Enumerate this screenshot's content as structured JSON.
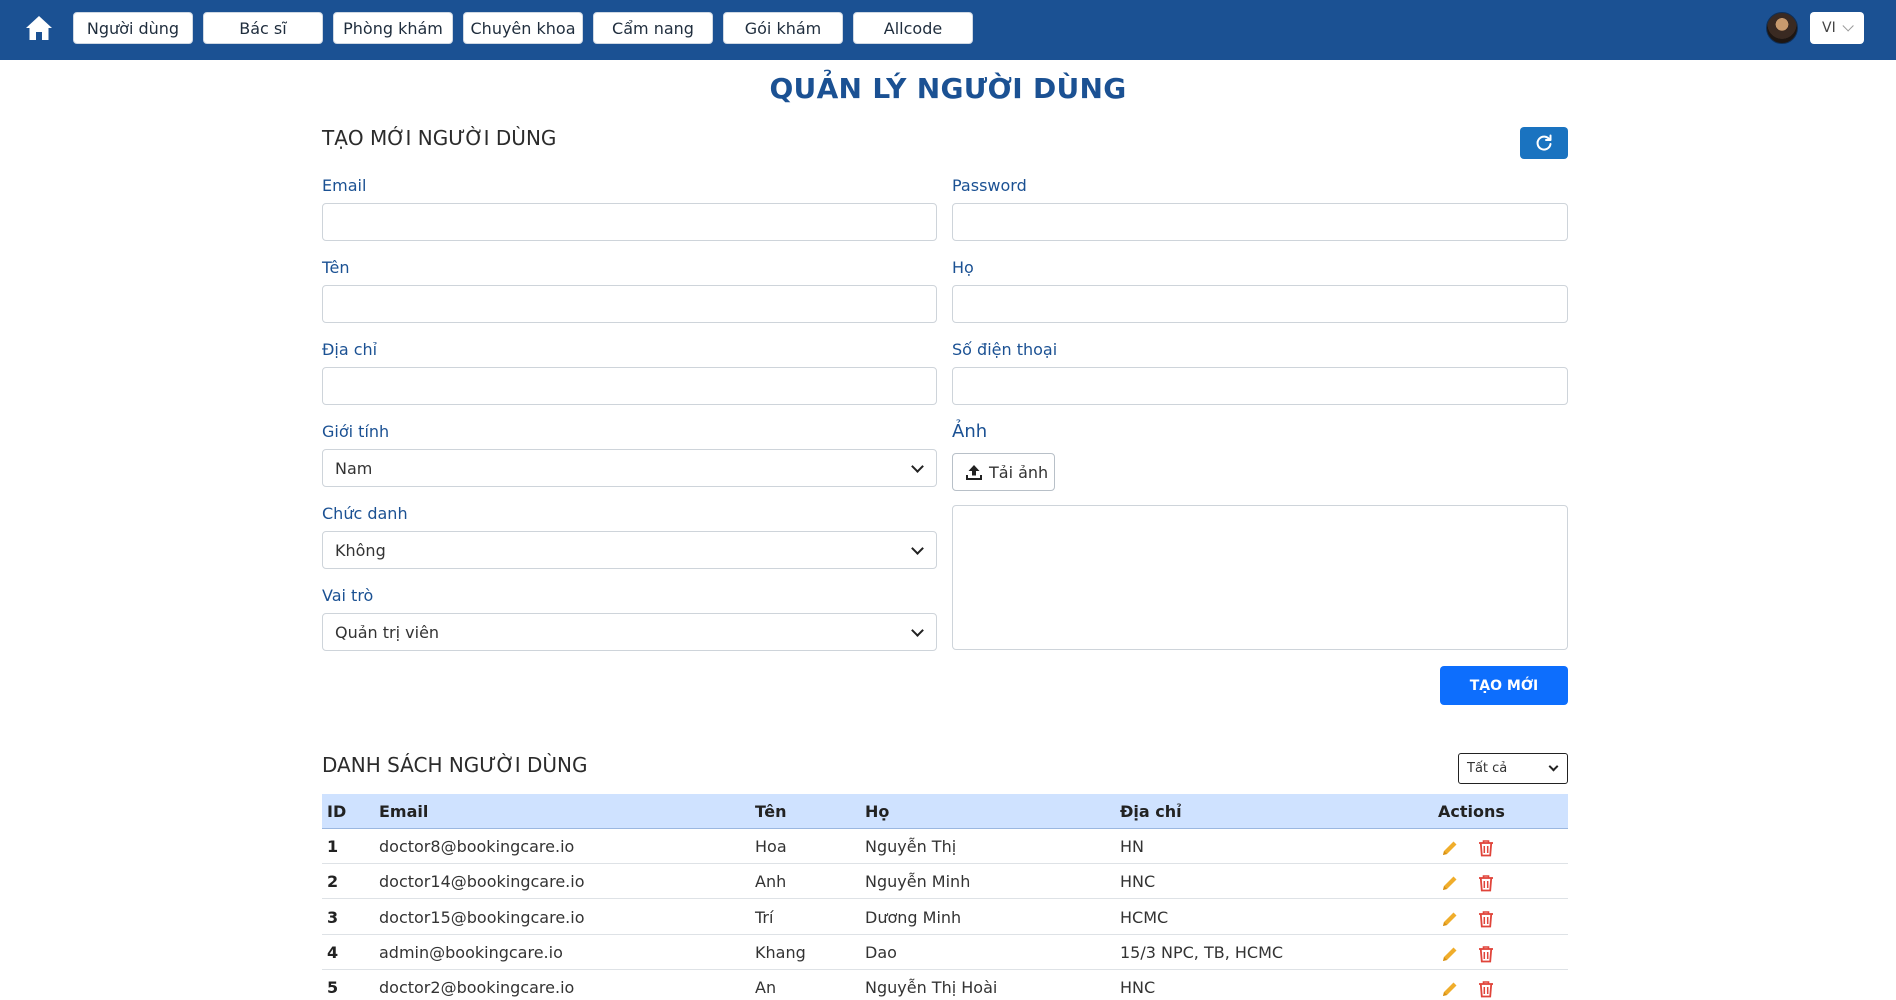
{
  "nav": {
    "items": [
      "Người dùng",
      "Bác sĩ",
      "Phòng khám",
      "Chuyên khoa",
      "Cẩm nang",
      "Gói khám",
      "Allcode"
    ],
    "lang": "VI"
  },
  "page_title": "QUẢN LÝ NGƯỜI DÙNG",
  "create_section": {
    "title": "TẠO MỚI NGƯỜI DÙNG",
    "labels": {
      "email": "Email",
      "password": "Password",
      "first_name": "Tên",
      "last_name": "Họ",
      "address": "Địa chỉ",
      "phone": "Số điện thoại",
      "gender": "Giới tính",
      "image": "Ảnh",
      "position": "Chức danh",
      "role": "Vai trò"
    },
    "values": {
      "email": "",
      "password": "",
      "first_name": "",
      "last_name": "",
      "address": "",
      "phone": "",
      "gender": "Nam",
      "position": "Không",
      "role": "Quản trị viên"
    },
    "upload_label": "Tải ảnh",
    "submit_label": "TẠO MỚI"
  },
  "list_section": {
    "title": "DANH SÁCH NGƯỜI DÙNG",
    "filter_value": "Tất cả",
    "columns": [
      "ID",
      "Email",
      "Tên",
      "Họ",
      "Địa chỉ",
      "Actions"
    ],
    "rows": [
      {
        "id": "1",
        "email": "doctor8@bookingcare.io",
        "first": "Hoa",
        "last": "Nguyễn Thị",
        "address": "HN"
      },
      {
        "id": "2",
        "email": "doctor14@bookingcare.io",
        "first": "Anh",
        "last": "Nguyễn Minh",
        "address": "HNC"
      },
      {
        "id": "3",
        "email": "doctor15@bookingcare.io",
        "first": "Trí",
        "last": "Dương Minh",
        "address": "HCMC"
      },
      {
        "id": "4",
        "email": "admin@bookingcare.io",
        "first": "Khang",
        "last": "Dao",
        "address": "15/3 NPC, TB, HCMC"
      },
      {
        "id": "5",
        "email": "doctor2@bookingcare.io",
        "first": "An",
        "last": "Nguyễn Thị Hoài",
        "address": "HNC"
      }
    ]
  },
  "colors": {
    "nav_bg": "#1b5193",
    "primary": "#0d6efd",
    "edit_icon": "#f0ad2b",
    "delete_icon": "#e0443a"
  },
  "icons": [
    "home-icon",
    "refresh-icon",
    "upload-icon",
    "edit-icon",
    "trash-icon",
    "chevron-down-icon"
  ]
}
